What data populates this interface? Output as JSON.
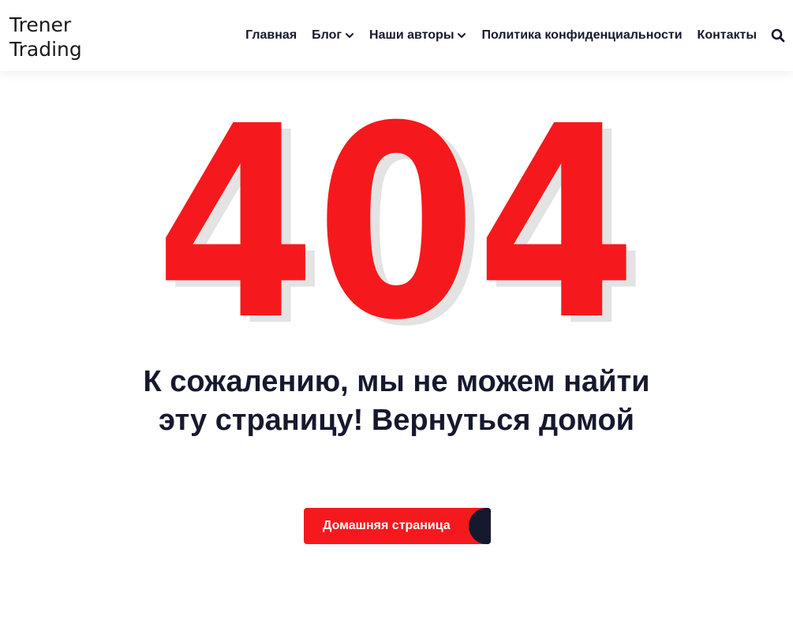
{
  "site": {
    "logo_line1": "Trener",
    "logo_line2": "Trading"
  },
  "nav": {
    "items": [
      {
        "label": "Главная",
        "has_dropdown": false
      },
      {
        "label": "Блог",
        "has_dropdown": true
      },
      {
        "label": "Наши авторы",
        "has_dropdown": true
      },
      {
        "label": "Политика конфиденциальности",
        "has_dropdown": false
      },
      {
        "label": "Контакты",
        "has_dropdown": false
      }
    ],
    "search_icon": "search-icon"
  },
  "error": {
    "code": "404",
    "message": "К сожалению, мы не можем найти эту страницу! Вернуться домой",
    "button_label": "Домашняя страница"
  },
  "colors": {
    "accent": "#f5191d",
    "dark": "#16192e",
    "shadow": "#e3e3e3"
  }
}
